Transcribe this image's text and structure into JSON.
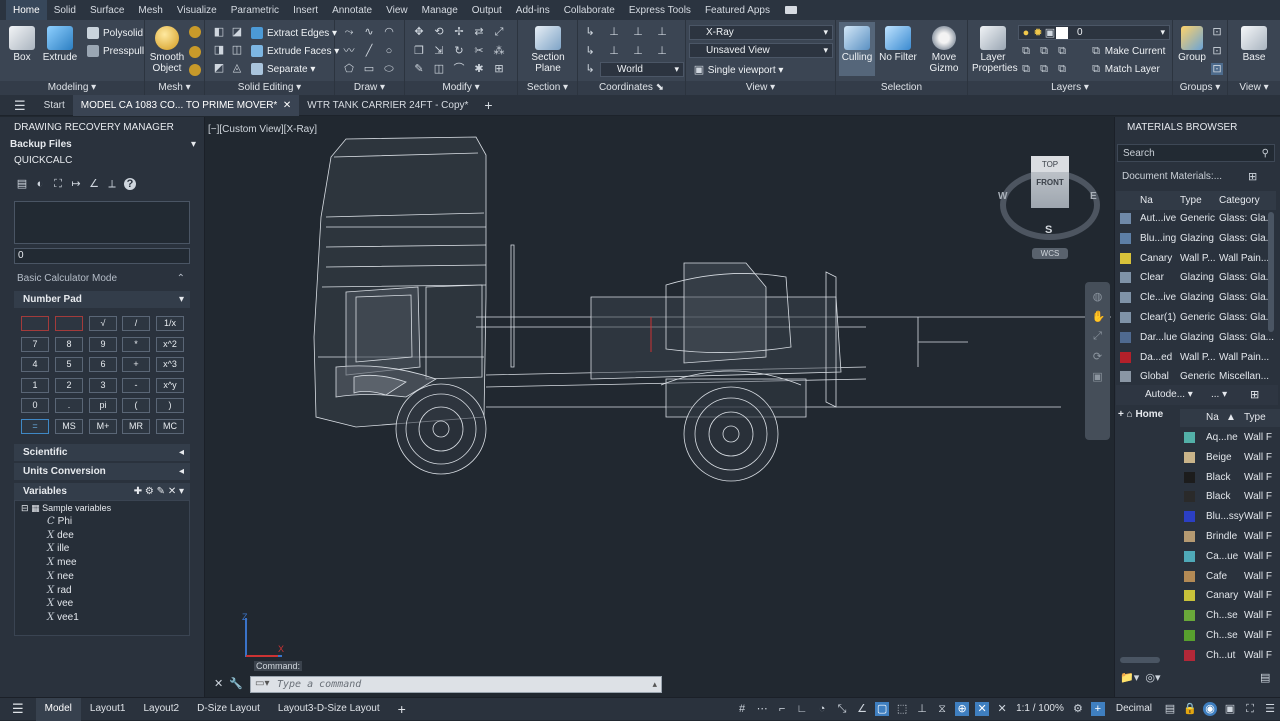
{
  "ribbon_tabs": [
    "Home",
    "Solid",
    "Surface",
    "Mesh",
    "Visualize",
    "Parametric",
    "Insert",
    "Annotate",
    "View",
    "Manage",
    "Output",
    "Add-ins",
    "Collaborate",
    "Express Tools",
    "Featured Apps"
  ],
  "panels": {
    "modeling": "Modeling",
    "mesh": "Mesh",
    "solid_editing": "Solid Editing",
    "draw": "Draw",
    "modify": "Modify",
    "section": "Section",
    "coordinates": "Coordinates",
    "view": "View",
    "selection": "Selection",
    "layers": "Layers",
    "groups": "Groups",
    "view2": "View"
  },
  "buttons": {
    "box": "Box",
    "extrude": "Extrude",
    "polysolid": "Polysolid",
    "presspull": "Presspull",
    "smooth_object": "Smooth Object",
    "extract_edges": "Extract Edges",
    "extrude_faces": "Extrude Faces",
    "separate": "Separate",
    "section_plane": "Section Plane",
    "xray": "X-Ray",
    "unsaved_view": "Unsaved View",
    "world": "World",
    "single_viewport": "Single viewport",
    "culling": "Culling",
    "no_filter": "No Filter",
    "move_gizmo": "Move Gizmo",
    "layer_properties": "Layer Properties",
    "make_current": "Make Current",
    "match_layer": "Match Layer",
    "layer_value": "0",
    "group": "Group",
    "base": "Base"
  },
  "file_tabs": {
    "start": "Start",
    "tab1": "MODEL CA 1083 CO... TO PRIME MOVER*",
    "tab2": "WTR TANK CARRIER 24FT - Copy*"
  },
  "left": {
    "drawing_recovery": "DRAWING RECOVERY MANAGER",
    "backup_files": "Backup Files",
    "quickcalc": "QUICKCALC",
    "display_value": "0",
    "mode": "Basic Calculator Mode",
    "number_pad": "Number Pad",
    "keys": [
      [
        "",
        "",
        "√",
        "/",
        "1/x"
      ],
      [
        "7",
        "8",
        "9",
        "*",
        "x^2"
      ],
      [
        "4",
        "5",
        "6",
        "+",
        "x^3"
      ],
      [
        "1",
        "2",
        "3",
        "-",
        "x^y"
      ],
      [
        "0",
        ".",
        "pi",
        "(",
        ")"
      ],
      [
        "=",
        "MS",
        "M+",
        "MR",
        "MC"
      ]
    ],
    "scientific": "Scientific",
    "units_conversion": "Units Conversion",
    "variables": "Variables",
    "sample_variables": "Sample variables",
    "vars": [
      "Phi",
      "dee",
      "ille",
      "mee",
      "nee",
      "rad",
      "vee",
      "vee1"
    ]
  },
  "viewport": {
    "label": "[−][Custom View][X-Ray]",
    "cube_top": "TOP",
    "cube_front": "FRONT",
    "compass_w": "W",
    "compass_e": "E",
    "compass_s": "S",
    "wcs": "WCS",
    "command_label": "Command:",
    "command_placeholder": "Type a command"
  },
  "materials": {
    "title": "MATERIALS BROWSER",
    "search_placeholder": "Search",
    "doc_materials": "Document Materials:...",
    "cols": [
      "Na",
      "Type",
      "Category"
    ],
    "rows": [
      {
        "name": "Aut...ive",
        "type": "Generic",
        "cat": "Glass: Gla...",
        "color": "#6f89a8"
      },
      {
        "name": "Blu...ing",
        "type": "Glazing",
        "cat": "Glass: Gla...",
        "color": "#5d7fa6"
      },
      {
        "name": "Canary",
        "type": "Wall P...",
        "cat": "Wall Pain...",
        "color": "#d8c23a"
      },
      {
        "name": "Clear",
        "type": "Glazing",
        "cat": "Glass: Gla...",
        "color": "#7f93a8"
      },
      {
        "name": "Cle...ive",
        "type": "Glazing",
        "cat": "Glass: Gla...",
        "color": "#7f93a8"
      },
      {
        "name": "Clear(1)",
        "type": "Generic",
        "cat": "Glass: Gla...",
        "color": "#7f93a8"
      },
      {
        "name": "Dar...lue",
        "type": "Glazing",
        "cat": "Glass: Gla...",
        "color": "#4f6a90"
      },
      {
        "name": "Da...ed",
        "type": "Wall P...",
        "cat": "Wall Pain...",
        "color": "#b3202a"
      },
      {
        "name": "Global",
        "type": "Generic",
        "cat": "Miscellan...",
        "color": "#8a96a4"
      }
    ],
    "lib_dropdown": "Autode...",
    "home": "Home",
    "lib_cols": [
      "Na",
      "Type"
    ],
    "lib_rows": [
      {
        "name": "Aq...ne",
        "type": "Wall F",
        "color": "#53b0a8"
      },
      {
        "name": "Beige",
        "type": "Wall F",
        "color": "#c9b48a"
      },
      {
        "name": "Black",
        "type": "Wall F",
        "color": "#1c1c1c"
      },
      {
        "name": "Black",
        "type": "Wall F",
        "color": "#2a2a2a"
      },
      {
        "name": "Blu...ssy",
        "type": "Wall F",
        "color": "#2b3fc4"
      },
      {
        "name": "Brindle",
        "type": "Wall F",
        "color": "#b59a72"
      },
      {
        "name": "Ca...ue",
        "type": "Wall F",
        "color": "#4fa9b8"
      },
      {
        "name": "Cafe",
        "type": "Wall F",
        "color": "#b38a55"
      },
      {
        "name": "Canary",
        "type": "Wall F",
        "color": "#c8c23a"
      },
      {
        "name": "Ch...se",
        "type": "Wall F",
        "color": "#6aa83a"
      },
      {
        "name": "Ch...se",
        "type": "Wall F",
        "color": "#58a02e"
      },
      {
        "name": "Ch...ut",
        "type": "Wall F",
        "color": "#b32838"
      }
    ]
  },
  "status": {
    "model": "Model",
    "layouts": [
      "Layout1",
      "Layout2",
      "D-Size Layout",
      "Layout3-D-Size Layout"
    ],
    "scale": "1:1 / 100%",
    "units": "Decimal"
  }
}
